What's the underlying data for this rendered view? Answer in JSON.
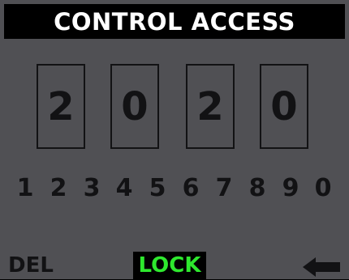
{
  "header": {
    "title": "CONTROL ACCESS"
  },
  "code_display": {
    "digits": [
      "2",
      "0",
      "2",
      "0"
    ]
  },
  "keypad": {
    "keys": [
      "1",
      "2",
      "3",
      "4",
      "5",
      "6",
      "7",
      "8",
      "9",
      "0"
    ]
  },
  "controls": {
    "delete_label": "DEL",
    "lock_label": "LOCK",
    "back_icon": "arrow-left-icon"
  },
  "colors": {
    "background": "#505054",
    "title_bar": "#000000",
    "title_text": "#ffffff",
    "digit_text": "#121214",
    "lock_text": "#2ee82e",
    "lock_bg": "#000000"
  }
}
